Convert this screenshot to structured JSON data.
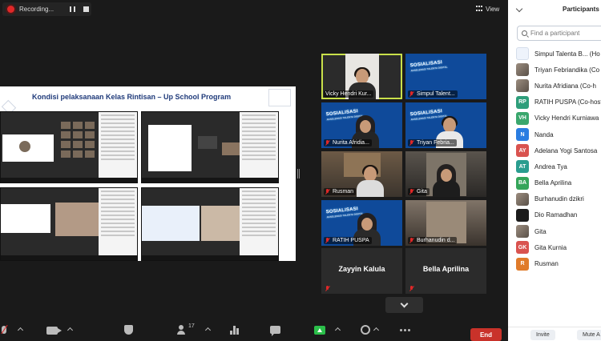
{
  "recording": {
    "label": "Recording..."
  },
  "view": {
    "label": "View"
  },
  "slide": {
    "title": "Kondisi pelaksanaan Kelas Rintisan – Up School Program"
  },
  "tiles": [
    {
      "name": "Vicky Hendri Kur...",
      "muted": false,
      "active": true,
      "kind": "person"
    },
    {
      "name": "Simpul Talent...",
      "muted": true,
      "active": false,
      "kind": "poster"
    },
    {
      "name": "Nurita Afridia...",
      "muted": true,
      "active": false,
      "kind": "poster-person"
    },
    {
      "name": "Triyan Febria...",
      "muted": true,
      "active": false,
      "kind": "poster-person"
    },
    {
      "name": "Rusman",
      "muted": true,
      "active": false,
      "kind": "room"
    },
    {
      "name": "Gita",
      "muted": true,
      "active": false,
      "kind": "room"
    },
    {
      "name": "RATIH PUSPA",
      "muted": true,
      "active": false,
      "kind": "poster-person"
    },
    {
      "name": "Burhanudin d...",
      "muted": true,
      "active": false,
      "kind": "room"
    },
    {
      "name": "Zayyin Kalula",
      "muted": true,
      "active": false,
      "kind": "name-only"
    },
    {
      "name": "Bella Aprilina",
      "muted": true,
      "active": false,
      "kind": "name-only"
    }
  ],
  "poster": {
    "line1": "SOSIALISASI",
    "line2": "AKSELERASI TALENTA DIGITAL"
  },
  "toolbar": {
    "participants_count": "17",
    "end_label": "End"
  },
  "panel": {
    "title": "Participants",
    "search_placeholder": "Find a participant",
    "participants": [
      {
        "name": "Simpul Talenta B... (Ho",
        "avatar": "logo",
        "initials": "",
        "color": "#eef3fb"
      },
      {
        "name": "Triyan Febriandika (Co",
        "avatar": "photo",
        "initials": "",
        "color": ""
      },
      {
        "name": "Nurita Afridiana (Co-h",
        "avatar": "photo",
        "initials": "",
        "color": ""
      },
      {
        "name": "RATIH PUSPA (Co-host",
        "avatar": "initials",
        "initials": "RP",
        "color": "#2e9e7a"
      },
      {
        "name": "Vicky Hendri Kurniawa",
        "avatar": "initials",
        "initials": "VH",
        "color": "#3aa76d"
      },
      {
        "name": "Nanda",
        "avatar": "initials",
        "initials": "N",
        "color": "#2a7de1"
      },
      {
        "name": "Adelana Yogi Santosa",
        "avatar": "initials",
        "initials": "AY",
        "color": "#d9534f"
      },
      {
        "name": "Andrea Tya",
        "avatar": "initials",
        "initials": "AT",
        "color": "#2a9d8f"
      },
      {
        "name": "Bella Aprilina",
        "avatar": "initials",
        "initials": "BA",
        "color": "#35a55a"
      },
      {
        "name": "Burhanudin dzikri",
        "avatar": "photo",
        "initials": "",
        "color": ""
      },
      {
        "name": "Dio Ramadhan",
        "avatar": "initials",
        "initials": "",
        "color": "#1b1b1b"
      },
      {
        "name": "Gita",
        "avatar": "photo",
        "initials": "",
        "color": ""
      },
      {
        "name": "Gita Kurnia",
        "avatar": "initials",
        "initials": "GK",
        "color": "#d9534f"
      },
      {
        "name": "Rusman",
        "avatar": "initials",
        "initials": "R",
        "color": "#e07b2a"
      }
    ],
    "invite_label": "Invite",
    "mute_label": "Mute A"
  }
}
